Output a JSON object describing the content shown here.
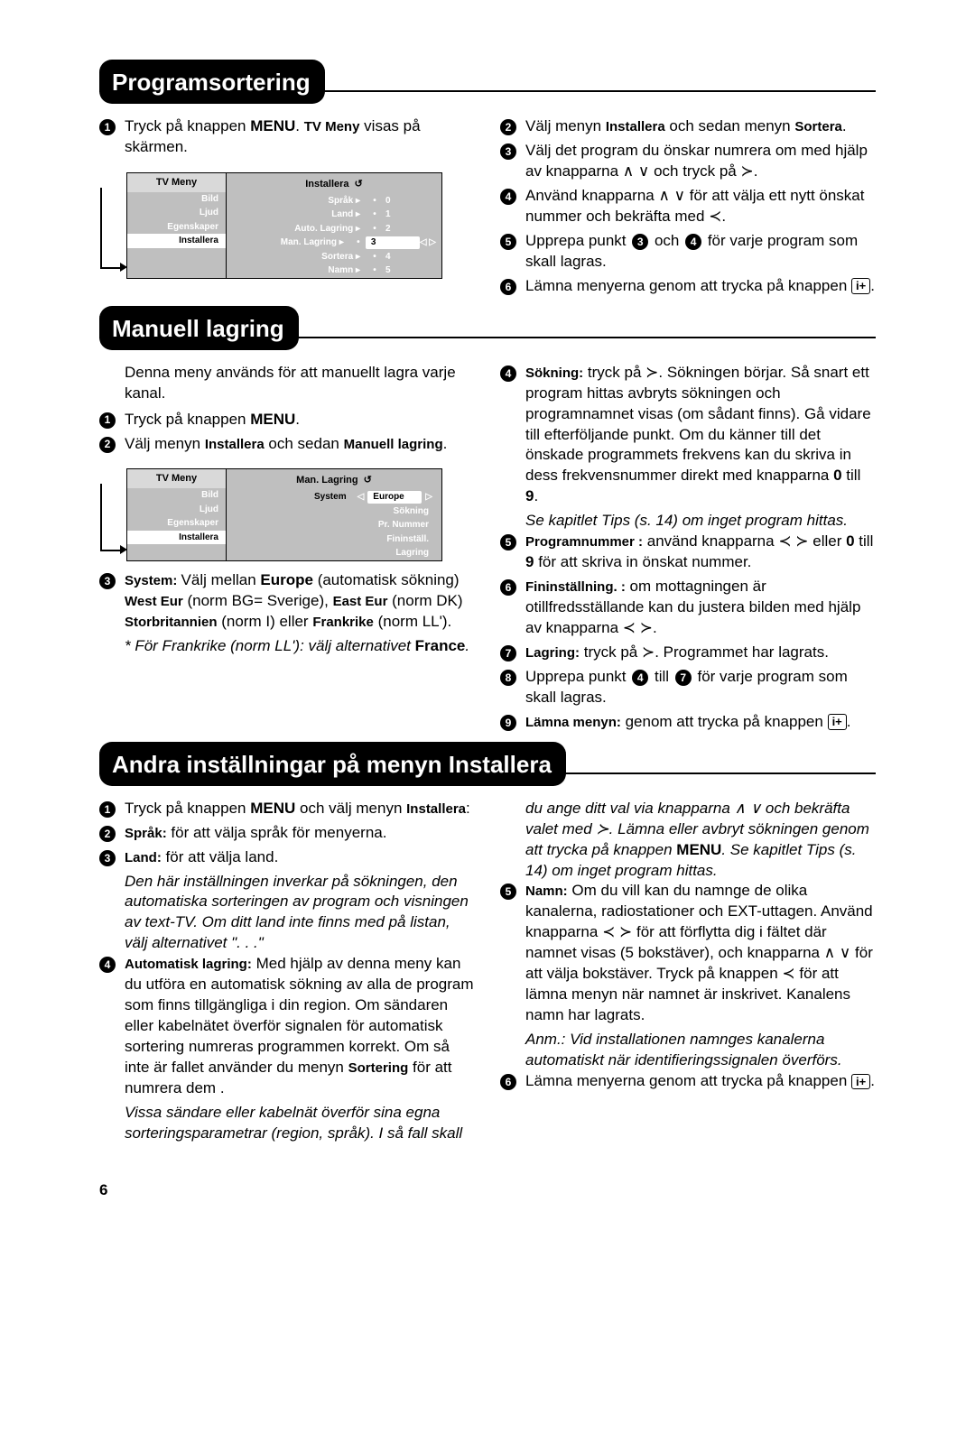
{
  "page_number": "6",
  "sec1": {
    "title": "Programsortering",
    "left": {
      "s1_pre": "Tryck på knappen ",
      "s1_b1": "MENU",
      "s1_mid1": ". ",
      "s1_b2": "TV Meny",
      "s1_post": " visas på skärmen."
    },
    "menu1": {
      "left_header": "TV Meny",
      "left_items": [
        "Bild",
        "Ljud",
        "Egenskaper",
        "Installera"
      ],
      "left_sel": 3,
      "right_header": "Installera",
      "rows": [
        {
          "label": "Språk",
          "val": "0"
        },
        {
          "label": "Land",
          "val": "1"
        },
        {
          "label": "Auto. Lagring",
          "val": "2"
        },
        {
          "label": "Man. Lagring",
          "val": "3"
        },
        {
          "label": "Sortera",
          "val": "4"
        },
        {
          "label": "Namn",
          "val": "5"
        }
      ],
      "sel_row": 3
    },
    "right": {
      "s2_a": "Välj menyn ",
      "s2_b1": "Installera",
      "s2_b": " och sedan menyn ",
      "s2_b2": "Sortera",
      "s2_c": ".",
      "s3": "Välj det program du önskar numrera om med hjälp av knapparna ∧ ∨ och tryck på ≻.",
      "s4": "Använd knapparna ∧ ∨ för att välja ett nytt önskat nummer och bekräfta med ≺.",
      "s5_a": "Upprepa punkt ",
      "s5_b": " och ",
      "s5_c": " för varje program som skall lagras.",
      "s6": "Lämna menyerna genom att trycka på knappen "
    }
  },
  "sec2": {
    "title": "Manuell lagring",
    "left": {
      "intro": "Denna meny används för att manuellt lagra varje kanal.",
      "s1_a": "Tryck på knappen ",
      "s1_b": "MENU",
      "s1_c": ".",
      "s2_a": "Välj menyn ",
      "s2_b1": "Installera",
      "s2_b": " och sedan ",
      "s2_b2": "Manuell lagring",
      "s2_c": ".",
      "menu2": {
        "left_header": "TV Meny",
        "left_items": [
          "Bild",
          "Ljud",
          "Egenskaper",
          "Installera"
        ],
        "left_sel": 3,
        "right_header": "Man. Lagring",
        "rows": [
          {
            "label": "System",
            "val": "Europe"
          },
          {
            "label": "Sökning",
            "val": ""
          },
          {
            "label": "Pr. Nummer",
            "val": ""
          },
          {
            "label": "Fininställ.",
            "val": ""
          },
          {
            "label": "Lagring",
            "val": ""
          }
        ],
        "sel_row": 0
      },
      "s3_a": "System: ",
      "s3_b": "Välj mellan ",
      "s3_c": "Europe",
      "s3_d": " (automatisk sökning) ",
      "s3_e": "West Eur",
      "s3_f": " (norm BG= Sverige), ",
      "s3_g": "East Eur",
      "s3_h": " (norm DK) ",
      "s3_i": "Storbritannien",
      "s3_j": " (norm I) eller ",
      "s3_k": "Frankrike",
      "s3_l": " (norm LL').",
      "s3_note": "* För Frankrike (norm LL'): välj alternativet ",
      "s3_note_b": "France",
      "s3_note_c": "."
    },
    "right": {
      "s4_a": "Sökning:",
      "s4_b": " tryck på ≻. Sökningen börjar. Så snart ett program hittas avbryts sökningen och programnamnet visas (om sådant finns). Gå vidare till efterföljande punkt. Om du känner till det önskade programmets frekvens kan du skriva in dess frekvensnummer direkt med knapparna ",
      "s4_c": "0",
      "s4_d": " till ",
      "s4_e": "9",
      "s4_f": ".",
      "s4_note": "Se kapitlet Tips (s. 14) om inget program hittas.",
      "s5_a": "Programnummer :",
      "s5_b": " använd knapparna ≺ ≻ eller ",
      "s5_c": "0",
      "s5_d": " till ",
      "s5_e": "9",
      "s5_f": " för att skriva in önskat nummer.",
      "s6_a": "Fininställning. :",
      "s6_b": " om mottagningen är otillfredsställande kan du justera bilden med hjälp av knapparna ≺ ≻.",
      "s7_a": "Lagring:",
      "s7_b": " tryck på ≻. Programmet har lagrats.",
      "s8_a": "Upprepa punkt ",
      "s8_b": " till ",
      "s8_c": " för varje program som skall lagras.",
      "s9_a": "Lämna menyn:",
      "s9_b": " genom att trycka på knappen "
    }
  },
  "sec3": {
    "title": "Andra inställningar på menyn Installera",
    "left": {
      "s1_a": "Tryck på knappen ",
      "s1_b": "MENU",
      "s1_c": " och välj menyn ",
      "s1_d": "Installera",
      "s1_e": ":",
      "s2_a": "Språk:",
      "s2_b": " för att välja språk för menyerna.",
      "s3_a": "Land:",
      "s3_b": " för att välja land.",
      "s3_note": "Den här inställningen inverkar på sökningen, den automatiska sorteringen av program och visningen av text-TV. Om ditt land inte finns med på listan, välj alternativet \". . .\"",
      "s4_a": "Automatisk lagring:",
      "s4_b": " Med hjälp av denna meny kan du utföra en automatisk sökning av alla de program som finns tillgängliga i din region. Om sändaren eller kabelnätet överför signalen för automatisk sortering numreras programmen korrekt. Om så inte är fallet använder du menyn ",
      "s4_c": "Sortering",
      "s4_d": " för att numrera dem .",
      "s4_note": "Vissa sändare eller kabelnät överför sina egna sorteringsparametrar (region, språk). I så fall skall"
    },
    "right": {
      "cont": "du ange ditt val via knapparna ∧ ∨ och bekräfta valet med ≻. Lämna eller avbryt sökningen genom att trycka på knappen ",
      "cont_b": "MENU",
      "cont_c": ". Se kapitlet Tips (s. 14) om inget program hittas.",
      "s5_a": "Namn:",
      "s5_b": " Om du vill kan du namnge de olika kanalerna, radiostationer och EXT-uttagen. Använd knapparna ≺ ≻ för att förflytta dig i fältet där namnet visas (5 bokstäver), och knapparna ∧ ∨ för att välja bokstäver. Tryck på knappen ≺ för att lämna menyn när namnet är inskrivet. Kanalens namn har lagrats.",
      "s5_note": "Anm.: Vid installationen namnges kanalerna automatiskt när identifieringssignalen överförs.",
      "s6": "Lämna menyerna genom att trycka på knappen "
    }
  }
}
